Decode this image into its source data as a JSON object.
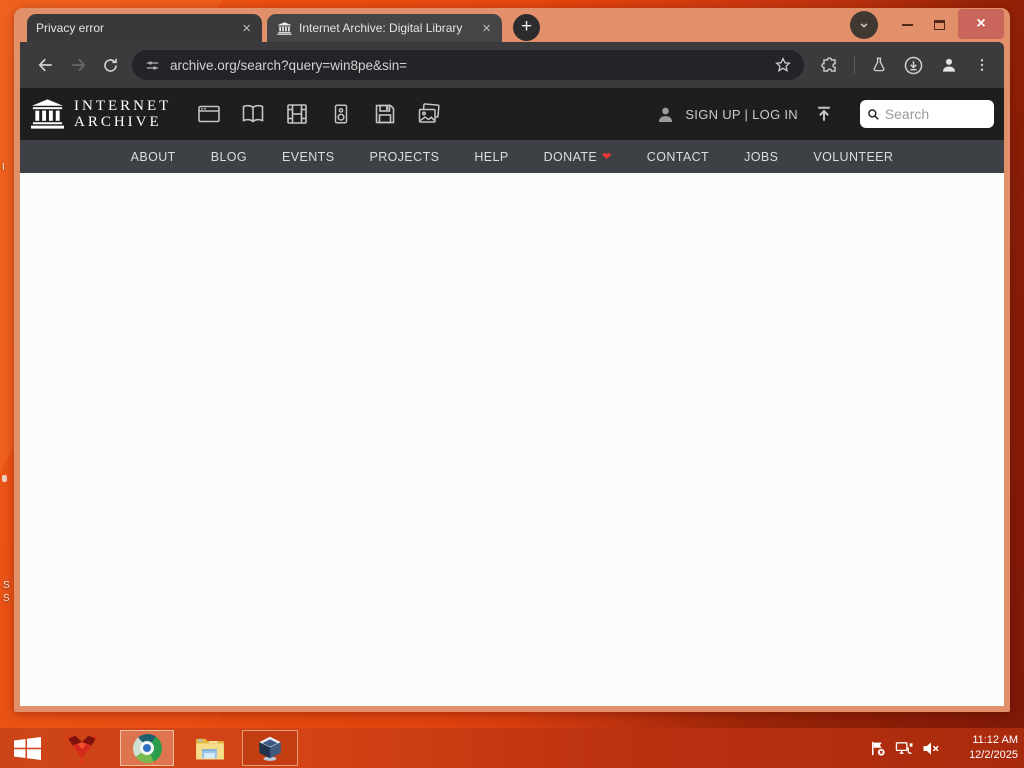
{
  "browser": {
    "tabs": [
      {
        "title": "Privacy error"
      },
      {
        "title": "Internet Archive: Digital Library"
      }
    ],
    "tab_close_glyph": "×",
    "new_tab_glyph": "+",
    "url": "archive.org/search?query=win8pe&sin=",
    "window_controls": {
      "close": "×"
    }
  },
  "ia": {
    "logo_line1": "INTERNET",
    "logo_line2": "ARCHIVE",
    "media_icons": [
      "web",
      "texts",
      "video",
      "audio",
      "software",
      "images"
    ],
    "account": "SIGN UP | LOG IN",
    "search_placeholder": "Search",
    "nav": [
      "ABOUT",
      "BLOG",
      "EVENTS",
      "PROJECTS",
      "HELP",
      "DONATE",
      "CONTACT",
      "JOBS",
      "VOLUNTEER"
    ],
    "donate_heart": "❤"
  },
  "taskbar": {
    "clock_time": "11:12 AM",
    "clock_date": "12/2/2025",
    "apps": [
      "start",
      "red-app",
      "chrome",
      "file-explorer",
      "virtualbox"
    ],
    "tray_icons": [
      "action-center-flag",
      "network",
      "volume-muted"
    ]
  },
  "desktop": {
    "fragments": [
      "I",
      "S",
      "S"
    ]
  },
  "colors": {
    "desktop_orange": "#e64510",
    "desktop_dark_red": "#8c1d09",
    "titlebar_salmon": "#e2906a",
    "taskbar_red": "#c43c13",
    "toolbar_dark": "#3b3a3d",
    "omnibox_dark": "#242327",
    "ia_header_black": "#1f1e1f",
    "ia_nav_gray": "#3d4044",
    "donate_heart_red": "#e53935",
    "close_button_red": "#c9655a",
    "page_white": "#fcfcfc"
  }
}
